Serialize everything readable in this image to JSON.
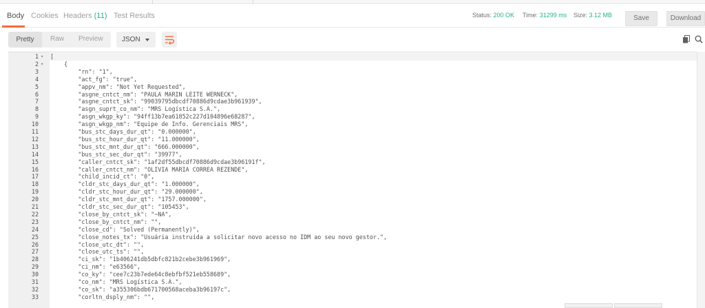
{
  "tabs": [
    {
      "label": "Body"
    },
    {
      "label": "Cookies"
    },
    {
      "label": "Headers",
      "count": "(11)"
    },
    {
      "label": "Test Results"
    }
  ],
  "status": {
    "label": "Status:",
    "value": "200 OK"
  },
  "time": {
    "label": "Time:",
    "value": "31299 ms"
  },
  "size": {
    "label": "Size:",
    "value": "3.12 MB"
  },
  "buttons": {
    "save": "Save",
    "download": "Download"
  },
  "view": {
    "pretty": "Pretty",
    "raw": "Raw",
    "preview": "Preview",
    "format": "JSON"
  },
  "icons": {
    "wrap": "wrap-lines-icon",
    "copy": "copy-icon",
    "search": "search-icon"
  },
  "colors": {
    "accent": "#f26b3a",
    "ok": "#26b47f"
  },
  "lines": [
    {
      "n": "1",
      "fold": true,
      "text": "["
    },
    {
      "n": "2",
      "fold": true,
      "text": "    {"
    },
    {
      "n": "3",
      "text": "        \"rn\": \"1\","
    },
    {
      "n": "4",
      "text": "        \"act_fg\": \"true\","
    },
    {
      "n": "5",
      "text": "        \"appv_nm\": \"Not Yet Requested\","
    },
    {
      "n": "6",
      "text": "        \"asgne_cntct_nm\": \"PAULA MARIN LEITE WERNECK\","
    },
    {
      "n": "7",
      "text": "        \"asgne_cntct_sk\": \"99039795dbcdf70886d9cdae3b961939\","
    },
    {
      "n": "8",
      "text": "        \"asgn_suprt_co_nm\": \"MRS Logística S.A.\","
    },
    {
      "n": "9",
      "text": "        \"asgn_wkgp_ky\": \"94ff13b7ea61852c227d104896e68287\","
    },
    {
      "n": "10",
      "text": "        \"asgn_wkgp_nm\": \"Equipe de Info. Gerenciais MRS\","
    },
    {
      "n": "11",
      "text": "        \"bus_stc_days_dur_qt\": \"0.000000\","
    },
    {
      "n": "12",
      "text": "        \"bus_stc_hour_dur_qt\": \"11.000000\","
    },
    {
      "n": "13",
      "text": "        \"bus_stc_mnt_dur_qt\": \"666.000000\","
    },
    {
      "n": "14",
      "text": "        \"bus_stc_sec_dur_qt\": \"39977\","
    },
    {
      "n": "15",
      "text": "        \"caller_cntct_sk\": \"1af2df55dbcdf70886d9cdae3b96191f\","
    },
    {
      "n": "16",
      "text": "        \"caller_cntct_nm\": \"OLIVIA MARIA CORREA REZENDE\","
    },
    {
      "n": "17",
      "text": "        \"child_incid_ct\": \"0\","
    },
    {
      "n": "18",
      "text": "        \"cldr_stc_days_dur_qt\": \"1.000000\","
    },
    {
      "n": "19",
      "text": "        \"cldr_stc_hour_dur_qt\": \"29.000000\","
    },
    {
      "n": "20",
      "text": "        \"cldr_stc_mnt_dur_qt\": \"1757.000000\","
    },
    {
      "n": "21",
      "text": "        \"cldr_stc_sec_dur_qt\": \"105453\","
    },
    {
      "n": "22",
      "text": "        \"close_by_cntct_sk\": \"~NA\","
    },
    {
      "n": "23",
      "text": "        \"close_by_cntct_nm\": \"\","
    },
    {
      "n": "24",
      "text": "        \"close_cd\": \"Solved (Permanently)\","
    },
    {
      "n": "25",
      "text": "        \"close_notes_tx\": \"Usuária instruída a solicitar novo acesso no IDM ao seu novo gestor.\","
    },
    {
      "n": "26",
      "text": "        \"close_utc_dt\": \"\","
    },
    {
      "n": "27",
      "text": "        \"close_utc_ts\": \"\","
    },
    {
      "n": "28",
      "text": "        \"ci_sk\": \"1b406241db5dbfc821b2cebe3b961969\","
    },
    {
      "n": "29",
      "text": "        \"ci_nm\": \"e63566\","
    },
    {
      "n": "30",
      "text": "        \"co_ky\": \"cee7c23b7ede64c8ebfbf521eb558689\","
    },
    {
      "n": "31",
      "text": "        \"co_nm\": \"MRS Logística S.A.\","
    },
    {
      "n": "32",
      "text": "        \"co_sk\": \"a355306bdb671700568aceba3b96197c\","
    },
    {
      "n": "33",
      "text": "        \"corltn_dsply_nm\": \"\","
    }
  ]
}
